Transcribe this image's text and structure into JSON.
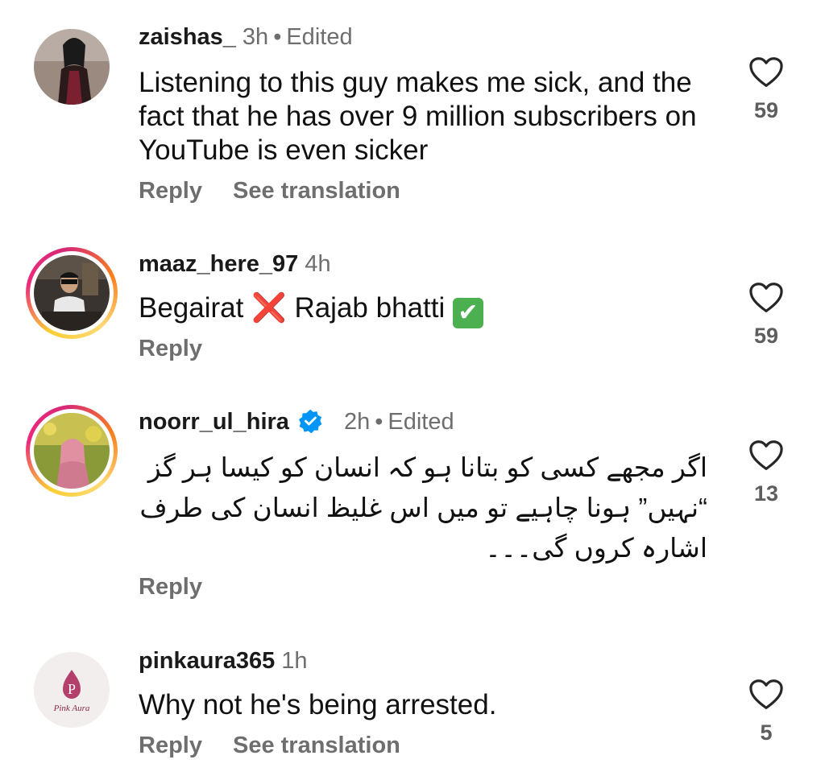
{
  "comments": [
    {
      "username": "zaishas_",
      "time": "3h",
      "edited": "Edited",
      "text": "Listening to this guy makes me sick, and the fact that he has over 9 million subscribers on YouTube is even sicker",
      "reply": "Reply",
      "translate": "See translation",
      "likes": "59"
    },
    {
      "username": "maaz_here_97",
      "time": "4h",
      "text_a": "Begairat",
      "text_x": "❌",
      "text_b": "Rajab bhatti",
      "text_check": "✔",
      "reply": "Reply",
      "likes": "59"
    },
    {
      "username": "noorr_ul_hira",
      "time": "2h",
      "edited": "Edited",
      "text": "اگر مجھے کسی کو بتانا ہو کہ انسان کو کیسا ہر گز “نہیں” ہونا چاہیے تو میں اس غلیظ انسان کی طرف اشارہ کروں گی۔۔۔",
      "reply": "Reply",
      "likes": "13"
    },
    {
      "username": "pinkaura365",
      "time": "1h",
      "avatar_text": "Pink Aura",
      "avatar_letter": "P",
      "text": "Why not he's being arrested.",
      "reply": "Reply",
      "translate": "See translation",
      "likes": "5"
    }
  ],
  "separator": "•",
  "colors": {
    "meta": "#6e6e6e",
    "verified": "#0095f6",
    "ring_start": "#f9ce34",
    "ring_end": "#ee2a7b"
  }
}
